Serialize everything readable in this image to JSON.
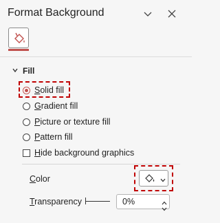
{
  "panel": {
    "title": "Format Background"
  },
  "tabs": {
    "fill_line_icon": "paint-bucket-icon"
  },
  "fill": {
    "section_label": "Fill",
    "options": [
      {
        "label": "Solid fill",
        "selected": true
      },
      {
        "label": "Gradient fill",
        "selected": false
      },
      {
        "label": "Picture or texture fill",
        "selected": false
      },
      {
        "label": "Pattern fill",
        "selected": false
      }
    ],
    "hide_graphics_label": "Hide background graphics",
    "hide_graphics_checked": false,
    "color_label": "Color",
    "transparency_label": "Transparency",
    "transparency_value": "0%"
  },
  "colors": {
    "accent": "#c0504d",
    "highlight": "#c00000"
  }
}
